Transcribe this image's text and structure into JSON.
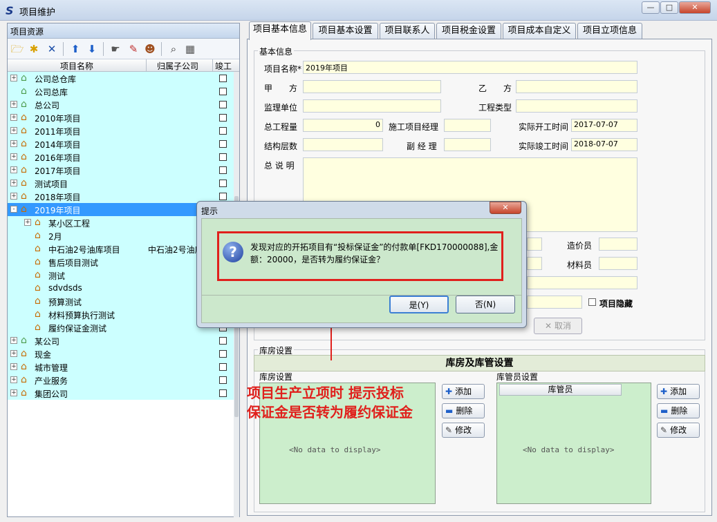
{
  "window": {
    "title": "项目维护",
    "icon": "app-s-icon",
    "buttons": [
      "minimize-icon",
      "maximize-icon",
      "close-icon"
    ]
  },
  "left": {
    "title": "项目资源",
    "columns": [
      "项目名称",
      "归属子公司",
      "竣工"
    ],
    "tree": [
      {
        "label": "公司总仓库",
        "sub": "",
        "level": 0,
        "expander": "+",
        "icon": "warehouse-icon"
      },
      {
        "label": "公司总库",
        "sub": "",
        "level": 0,
        "expander": "",
        "icon": "warehouse-icon"
      },
      {
        "label": "总公司",
        "sub": "",
        "level": 0,
        "expander": "+",
        "icon": "warehouse-icon"
      },
      {
        "label": "2010年项目",
        "sub": "",
        "level": 0,
        "expander": "+",
        "icon": "house-icon"
      },
      {
        "label": "2011年项目",
        "sub": "",
        "level": 0,
        "expander": "+",
        "icon": "house-icon"
      },
      {
        "label": "2014年项目",
        "sub": "",
        "level": 0,
        "expander": "+",
        "icon": "house-icon"
      },
      {
        "label": "2016年项目",
        "sub": "",
        "level": 0,
        "expander": "+",
        "icon": "house-icon"
      },
      {
        "label": "2017年项目",
        "sub": "",
        "level": 0,
        "expander": "+",
        "icon": "house-icon"
      },
      {
        "label": "测试项目",
        "sub": "",
        "level": 0,
        "expander": "+",
        "icon": "house-icon"
      },
      {
        "label": "2018年项目",
        "sub": "",
        "level": 0,
        "expander": "+",
        "icon": "house-icon"
      },
      {
        "label": "2019年项目",
        "sub": "",
        "level": 0,
        "expander": "-",
        "icon": "house-icon",
        "selected": true
      },
      {
        "label": "某小区工程",
        "sub": "",
        "level": 1,
        "expander": "+",
        "icon": "house-icon"
      },
      {
        "label": "2月",
        "sub": "",
        "level": 1,
        "expander": "",
        "icon": "house-icon"
      },
      {
        "label": "中石油2号油库项目",
        "sub": "中石油2号油库",
        "level": 1,
        "expander": "",
        "icon": "house-icon"
      },
      {
        "label": "售后项目测试",
        "sub": "",
        "level": 1,
        "expander": "",
        "icon": "house-icon"
      },
      {
        "label": "测试",
        "sub": "",
        "level": 1,
        "expander": "",
        "icon": "house-icon"
      },
      {
        "label": "sdvdsds",
        "sub": "",
        "level": 1,
        "expander": "",
        "icon": "house-icon"
      },
      {
        "label": "预算测试",
        "sub": "",
        "level": 1,
        "expander": "",
        "icon": "house-icon"
      },
      {
        "label": "材料预算执行测试",
        "sub": "",
        "level": 1,
        "expander": "",
        "icon": "house-icon"
      },
      {
        "label": "履约保证金测试",
        "sub": "",
        "level": 1,
        "expander": "",
        "icon": "house-icon"
      },
      {
        "label": "某公司",
        "sub": "",
        "level": 0,
        "expander": "+",
        "icon": "warehouse-icon"
      },
      {
        "label": "现金",
        "sub": "",
        "level": 0,
        "expander": "+",
        "icon": "house-icon"
      },
      {
        "label": "城市管理",
        "sub": "",
        "level": 0,
        "expander": "+",
        "icon": "house-icon"
      },
      {
        "label": "产业服务",
        "sub": "",
        "level": 0,
        "expander": "+",
        "icon": "house-icon"
      },
      {
        "label": "集团公司",
        "sub": "",
        "level": 0,
        "expander": "+",
        "icon": "house-icon"
      }
    ]
  },
  "tabs": [
    "项目基本信息",
    "项目基本设置",
    "项目联系人",
    "项目税金设置",
    "项目成本自定义",
    "项目立项信息"
  ],
  "basic": {
    "legend": "基本信息",
    "name_label": "项目名称*",
    "name_value": "2019年项目",
    "party_a_label": "甲　　方",
    "party_b_label": "乙　　方",
    "supervisor_label": "监理单位",
    "project_type_label": "工程类型",
    "total_qty_label": "总工程量",
    "total_qty_value": "0",
    "manager_label": "施工项目经理",
    "actual_start_label": "实际开工时间",
    "actual_start_value": "2017-07-07",
    "structure_label": "结构层数",
    "deputy_label": "副 经 理",
    "actual_end_label": "实际竣工时间",
    "actual_end_value": "2018-07-07",
    "desc_label": "总 说 明",
    "cost_clerk_label": "造价员",
    "material_clerk_label": "材料员",
    "hidden_label": "项目隐藏",
    "cancel_label": "取消"
  },
  "storage": {
    "legend": "库房设置",
    "title": "库房及库管设置",
    "warehouse_label": "库房设置",
    "keeper_label": "库管员设置",
    "keeper_column": "库管员",
    "no_data": "<No data to display>",
    "add": "添加",
    "delete": "删除",
    "edit": "修改"
  },
  "dialog": {
    "title": "提示",
    "message": "发现对应的开拓项目有“投标保证金”的付款单[FKD170000088],金额：20000，是否转为履约保证金？",
    "yes": "是(Y)",
    "no": "否(N)"
  },
  "annotation": {
    "line1": "项目生产立项时 提示投标",
    "line2": "保证金是否转为履约保证金",
    "color": "#e0201c"
  }
}
